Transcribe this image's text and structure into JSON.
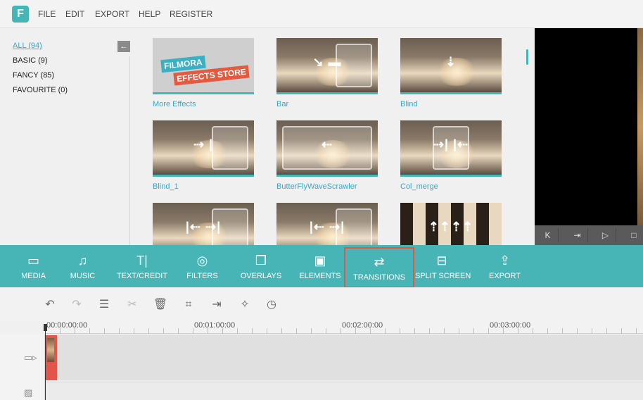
{
  "menu": {
    "logo": "F",
    "items": [
      "FILE",
      "EDIT",
      "EXPORT",
      "HELP",
      "REGISTER"
    ]
  },
  "categories": {
    "back_icon": "arrow-left-icon",
    "items": [
      {
        "label": "ALL (94)",
        "active": true
      },
      {
        "label": "BASIC (9)",
        "active": false
      },
      {
        "label": "FANCY (85)",
        "active": false
      },
      {
        "label": "FAVOURITE (0)",
        "active": false
      }
    ]
  },
  "effects": {
    "store_line1": "FILMORA",
    "store_line2": "EFFECTS STORE",
    "tiles": [
      {
        "label": "More Effects",
        "icon": "store-banner"
      },
      {
        "label": "Bar",
        "icon": "staircase-arrow-icon"
      },
      {
        "label": "Blind",
        "icon": "blind-down-arrow-icon"
      },
      {
        "label": "Blind_1",
        "icon": "arrow-right-icon"
      },
      {
        "label": "ButterFlyWaveScrawler",
        "icon": "arrow-left-icon"
      },
      {
        "label": "Col_merge",
        "icon": "merge-arrows-icon"
      },
      {
        "label": "",
        "icon": "split-arrows-icon"
      },
      {
        "label": "",
        "icon": "cross-arrows-icon"
      },
      {
        "label": "",
        "icon": "checker-arrows-icon"
      }
    ],
    "glyphs": [
      "",
      "↘ ▬",
      "⇣",
      "⇢ |",
      "⇠",
      "⇢| |⇠",
      "|⇠ ⇢|",
      "|⇠ ⇢|",
      "⇡⇡⇡⇡"
    ]
  },
  "player": {
    "buttons": [
      "K",
      "⇥",
      "▷",
      "□"
    ]
  },
  "toolbar": {
    "accent": "#47b4b6",
    "selected_color": "#e2554a",
    "items": [
      {
        "label": "MEDIA",
        "icon": "folder-icon",
        "glyph": "▭"
      },
      {
        "label": "MUSIC",
        "icon": "music-note-icon",
        "glyph": "♫"
      },
      {
        "label": "TEXT/CREDIT",
        "icon": "text-icon",
        "glyph": "T|"
      },
      {
        "label": "FILTERS",
        "icon": "filters-icon",
        "glyph": "◎"
      },
      {
        "label": "OVERLAYS",
        "icon": "overlays-icon",
        "glyph": "❒"
      },
      {
        "label": "ELEMENTS",
        "icon": "image-icon",
        "glyph": "▣"
      },
      {
        "label": "TRANSITIONS",
        "icon": "transitions-icon",
        "glyph": "⇄"
      },
      {
        "label": "SPLIT SCREEN",
        "icon": "split-screen-icon",
        "glyph": "⊟"
      },
      {
        "label": "EXPORT",
        "icon": "export-icon",
        "glyph": "⇪"
      }
    ]
  },
  "edit_tools": [
    {
      "name": "undo-icon",
      "glyph": "↶"
    },
    {
      "name": "redo-icon",
      "glyph": "↷"
    },
    {
      "name": "adjust-icon",
      "glyph": "☰"
    },
    {
      "name": "scissors-icon",
      "glyph": "✂"
    },
    {
      "name": "trash-icon",
      "glyph": "🗑"
    },
    {
      "name": "crop-icon",
      "glyph": "⌗"
    },
    {
      "name": "insert-icon",
      "glyph": "⇥"
    },
    {
      "name": "magic-wand-icon",
      "glyph": "✧"
    },
    {
      "name": "clock-icon",
      "glyph": "◷"
    }
  ],
  "timeline": {
    "ticks": [
      "00:00:00:00",
      "00:01:00:00",
      "00:02:00:00",
      "00:03:00:00"
    ],
    "video_track_icon": "video-camera-icon",
    "image_track_icon": "image-icon",
    "video_glyph": "▭▹",
    "image_glyph": "▨"
  }
}
